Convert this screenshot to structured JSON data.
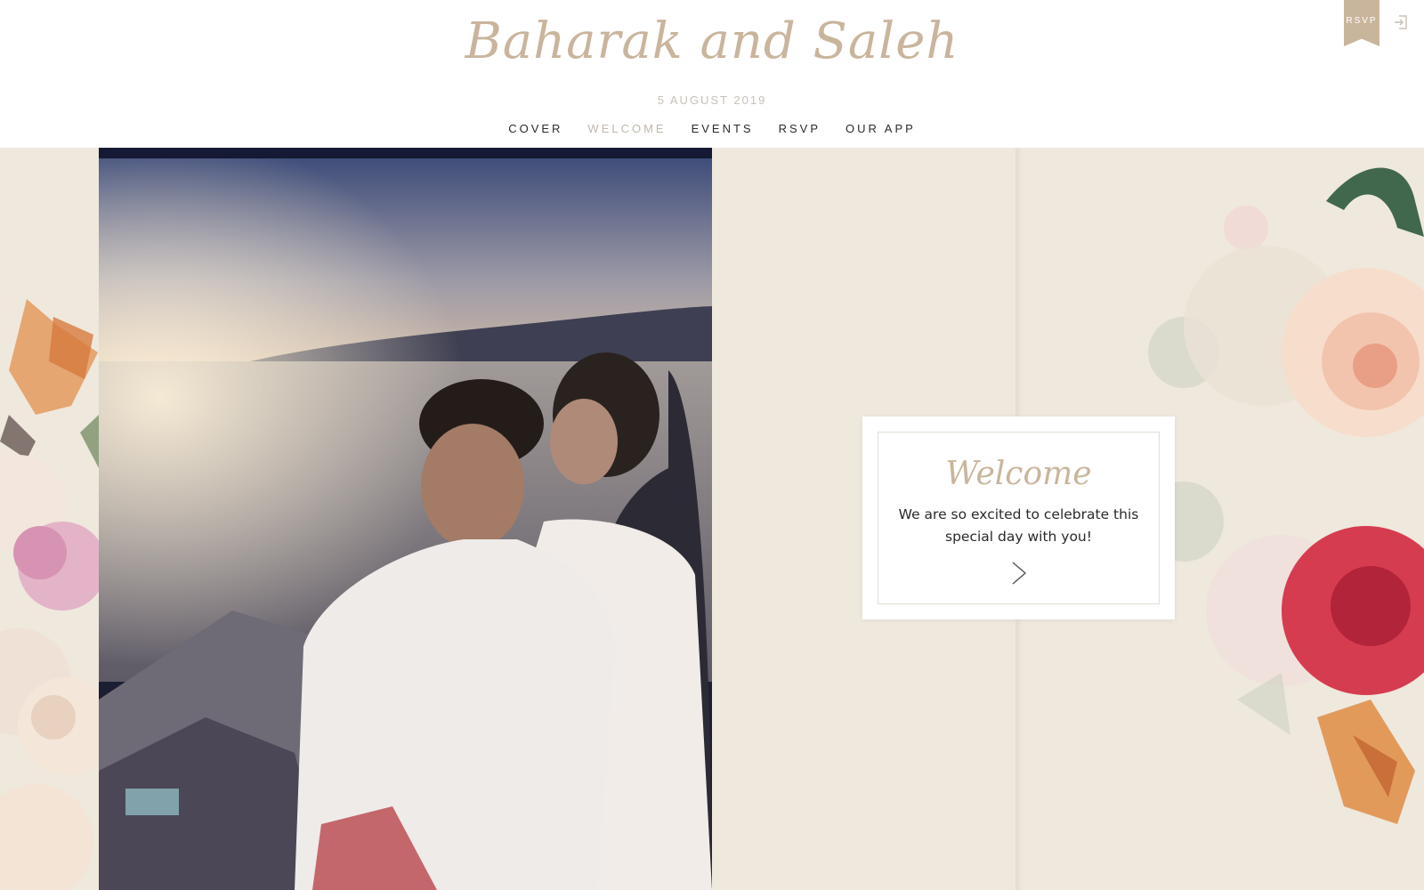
{
  "header": {
    "logo_text": "Baharak and Saleh",
    "date": "5 AUGUST 2019",
    "nav": [
      {
        "label": "COVER",
        "active": false
      },
      {
        "label": "WELCOME",
        "active": true
      },
      {
        "label": "EVENTS",
        "active": false
      },
      {
        "label": "RSVP",
        "active": false
      },
      {
        "label": "OUR APP",
        "active": false
      }
    ],
    "rsvp_ribbon": "RSVP",
    "login_icon": "login-icon"
  },
  "colors": {
    "accent": "#c9b59c",
    "background": "#efe8dd",
    "nav_text": "#2b2b2b",
    "nav_active": "#c0b8ad"
  },
  "welcome_card": {
    "title": "Welcome",
    "message": "We are so excited to celebrate this special day with you!",
    "next_icon": "chevron-right-icon"
  }
}
